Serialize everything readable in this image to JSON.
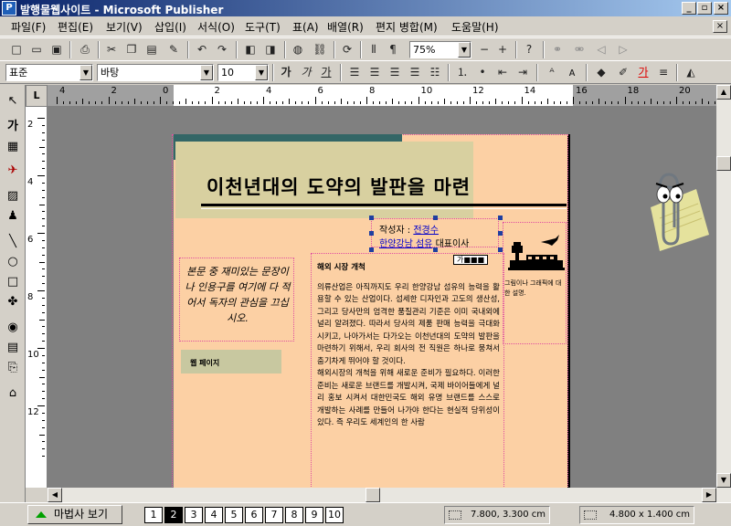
{
  "window": {
    "title": "발행물웹사이트 - Microsoft Publisher",
    "app_icon": "publisher-icon"
  },
  "menu": {
    "items": [
      "파일(F)",
      "편집(E)",
      "보기(V)",
      "삽입(I)",
      "서식(O)",
      "도구(T)",
      "표(A)",
      "배열(R)",
      "편지 병합(M)",
      "도움말(H)"
    ]
  },
  "toolbar": {
    "zoom": "75%",
    "buttons": [
      "new-icon",
      "open-icon",
      "save-icon",
      "print-icon",
      "cut-icon",
      "copy-icon",
      "paste-icon",
      "format-painter-icon",
      "undo-icon",
      "redo-icon",
      "bring-front-icon",
      "send-back-icon",
      "web-icon",
      "hyperlink-icon",
      "refresh-icon",
      "columns-icon",
      "paragraph-icon",
      "zoom-out-icon",
      "zoom-in-icon",
      "help-icon"
    ]
  },
  "format": {
    "style": "표준",
    "font": "바탕",
    "size": "10",
    "bold_label": "가",
    "italic_label": "가",
    "underline_label": "가",
    "font_color_label": "가"
  },
  "ruler": {
    "corner_label": "L",
    "h_numbers": [
      "4",
      "2",
      "0",
      "2",
      "4",
      "6",
      "8",
      "10",
      "12",
      "14",
      "16",
      "18",
      "20"
    ],
    "v_numbers": [
      "2",
      "4",
      "6",
      "8",
      "10",
      "12"
    ]
  },
  "document": {
    "headline": "이천년대의 도약의 발판을 마련",
    "author_prefix": "작성자 :",
    "author_name": "전경수",
    "company": "한양강남 섬유",
    "role": "대표이사",
    "small_frame": "가■■■",
    "quote": "본문 중 재미있는 문장이나 인용구를 여기에 다 적어서 독자의 관심을 끄십시오.",
    "label": "웹 페이지",
    "article_heading": "해외 시장 개척",
    "article_p1": "의류산업은 아직까지도 우리 한양강남 섬유의 능력을 활용할 수 있는 산업이다. 섬세한 디자인과 고도의 생산성, 그리고 당사만의 엄격한 품질관리 기준은 이미 국내외에 널리 알려졌다. 따라서 당사의 제품 판매 능력을 극대화 시키고, 나아가서는 다가오는 이천년대의 도약의 발판을 마련하기 위해서, 우리 회사의 전 직원은 하나로 뭉쳐서 춤기차게 뛰어야 할 것이다.",
    "article_p2": "해외시장의 개척을 위해 새로운 준비가 필요하다. 이러한 준비는 새로운 브랜드를 개발시켜, 국제 바이어들에게 널리 홍보 시켜서 대한민국도 해외 유명 브랜드를 스스로 개발하는 사례를 만들어 나가야 한다는 현실적 당위성이 있다. 즉 우리도 세계인의 한 사람",
    "caption": "그림이나 그래픽에 대한 설명."
  },
  "status": {
    "wizard": "마법사 보기",
    "pages": [
      "1",
      "2",
      "3",
      "4",
      "5",
      "6",
      "7",
      "8",
      "9",
      "10"
    ],
    "active_page": "2",
    "position": "7.800, 3.300 cm",
    "size": "4.800 x 1.400 cm"
  },
  "colors": {
    "page": "#fcd0a4",
    "banner": "#336666",
    "title_band": "#d8d0a0",
    "canvas": "#808080"
  }
}
